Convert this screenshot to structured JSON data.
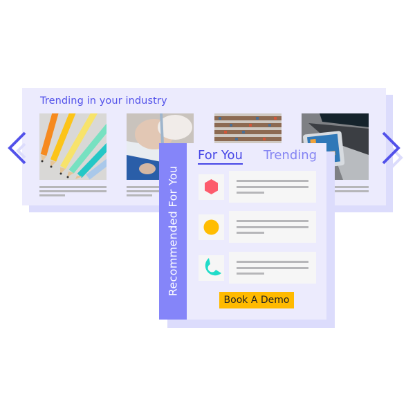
{
  "carousel": {
    "title": "Trending in your industry",
    "prev_icon": "chevron-left-icon",
    "next_icon": "chevron-right-icon",
    "accent_color": "#5251ea",
    "items": [
      {
        "image": "colored-pencils-photo"
      },
      {
        "image": "hand-writing-notebook-photo"
      },
      {
        "image": "library-bookshelves-photo"
      },
      {
        "image": "laptop-tablet-photo"
      }
    ]
  },
  "recommendations": {
    "side_label": "Recommended For You",
    "side_color": "#8585f9",
    "tabs": [
      {
        "label": "For You",
        "active": true
      },
      {
        "label": "Trending",
        "active": false
      }
    ],
    "items": [
      {
        "icon": "hexagon-icon",
        "color": "#fd5c6c"
      },
      {
        "icon": "circle-icon",
        "color": "#ffbd00"
      },
      {
        "icon": "pie-segment-icon",
        "color": "#20dcc9"
      }
    ],
    "cta_label": "Book A Demo",
    "cta_color": "#ffba00"
  }
}
